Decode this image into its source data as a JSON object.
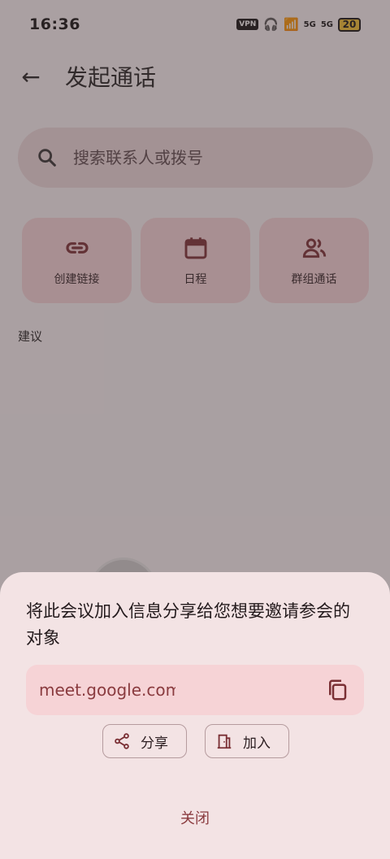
{
  "status": {
    "time": "16:36",
    "vpn": "VPN",
    "signal1": "5G",
    "signal2": "5G",
    "battery": "20"
  },
  "header": {
    "title": "发起通话"
  },
  "search": {
    "placeholder": "搜索联系人或拨号"
  },
  "cards": [
    {
      "label": "创建链接",
      "icon": "link-icon"
    },
    {
      "label": "日程",
      "icon": "calendar-icon"
    },
    {
      "label": "群组通话",
      "icon": "group-icon"
    }
  ],
  "section": {
    "suggestions": "建议"
  },
  "sheet": {
    "message": "将此会议加入信息分享给您想要邀请参会的对象",
    "link": "meet.google.com/",
    "share_label": "分享",
    "join_label": "加入",
    "close_label": "关闭"
  },
  "colors": {
    "accent": "#8a3b3f",
    "card_bg": "#f8d7da",
    "sheet_bg": "#f3e3e4"
  }
}
